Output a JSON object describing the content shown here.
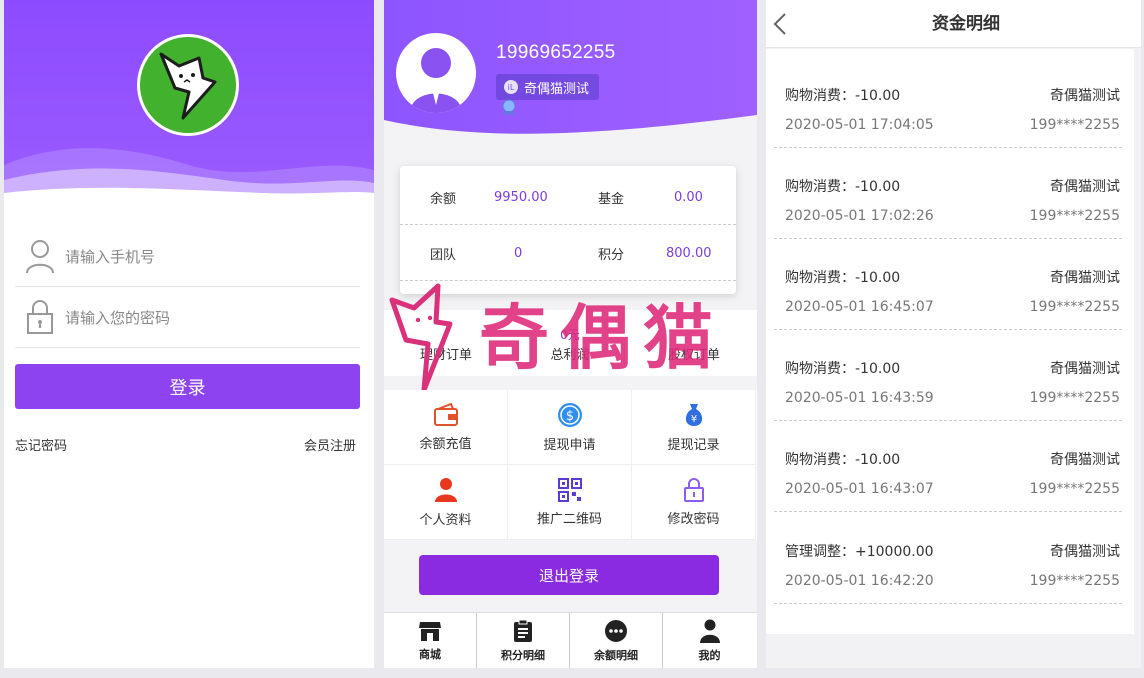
{
  "login": {
    "phone_placeholder": "请输入手机号",
    "password_placeholder": "请输入您的密码",
    "login_button": "登录",
    "forgot_password": "忘记密码",
    "register": "会员注册"
  },
  "member": {
    "phone": "19969652255",
    "nickname": "奇偶猫测试",
    "badge_text": "iL",
    "balances": [
      {
        "label": "余额",
        "value": "9950.00"
      },
      {
        "label": "基金",
        "value": "0.00"
      },
      {
        "label": "团队",
        "value": "0"
      },
      {
        "label": "积分",
        "value": "800.00"
      }
    ],
    "stats": [
      {
        "value": "",
        "label": "理财订单"
      },
      {
        "value": "0元",
        "label": "总利润"
      },
      {
        "value": "",
        "label": "股权订单"
      }
    ],
    "menu": [
      {
        "label": "余额充值",
        "icon": "wallet-icon"
      },
      {
        "label": "提现申请",
        "icon": "dollar-coin-icon"
      },
      {
        "label": "提现记录",
        "icon": "money-bag-icon"
      },
      {
        "label": "个人资料",
        "icon": "user-icon"
      },
      {
        "label": "推广二维码",
        "icon": "qrcode-icon"
      },
      {
        "label": "修改密码",
        "icon": "lock-icon"
      }
    ],
    "logout_button": "退出登录",
    "tabs": [
      {
        "label": "商城",
        "icon": "store-icon"
      },
      {
        "label": "积分明细",
        "icon": "clipboard-icon"
      },
      {
        "label": "余额明细",
        "icon": "chat-icon"
      },
      {
        "label": "我的",
        "icon": "person-icon"
      }
    ],
    "watermark": "奇偶猫",
    "colors": {
      "accent": "#8a2be2",
      "value": "#7a3ce0"
    }
  },
  "funds": {
    "title": "资金明细",
    "records": [
      {
        "type": "购物消费：-10.00",
        "user": "奇偶猫测试",
        "time": "2020-05-01 17:04:05",
        "phone": "199****2255"
      },
      {
        "type": "购物消费：-10.00",
        "user": "奇偶猫测试",
        "time": "2020-05-01 17:02:26",
        "phone": "199****2255"
      },
      {
        "type": "购物消费：-10.00",
        "user": "奇偶猫测试",
        "time": "2020-05-01 16:45:07",
        "phone": "199****2255"
      },
      {
        "type": "购物消费：-10.00",
        "user": "奇偶猫测试",
        "time": "2020-05-01 16:43:59",
        "phone": "199****2255"
      },
      {
        "type": "购物消费：-10.00",
        "user": "奇偶猫测试",
        "time": "2020-05-01 16:43:07",
        "phone": "199****2255"
      },
      {
        "type": "管理调整：+10000.00",
        "user": "奇偶猫测试",
        "time": "2020-05-01 16:42:20",
        "phone": "199****2255"
      }
    ]
  }
}
